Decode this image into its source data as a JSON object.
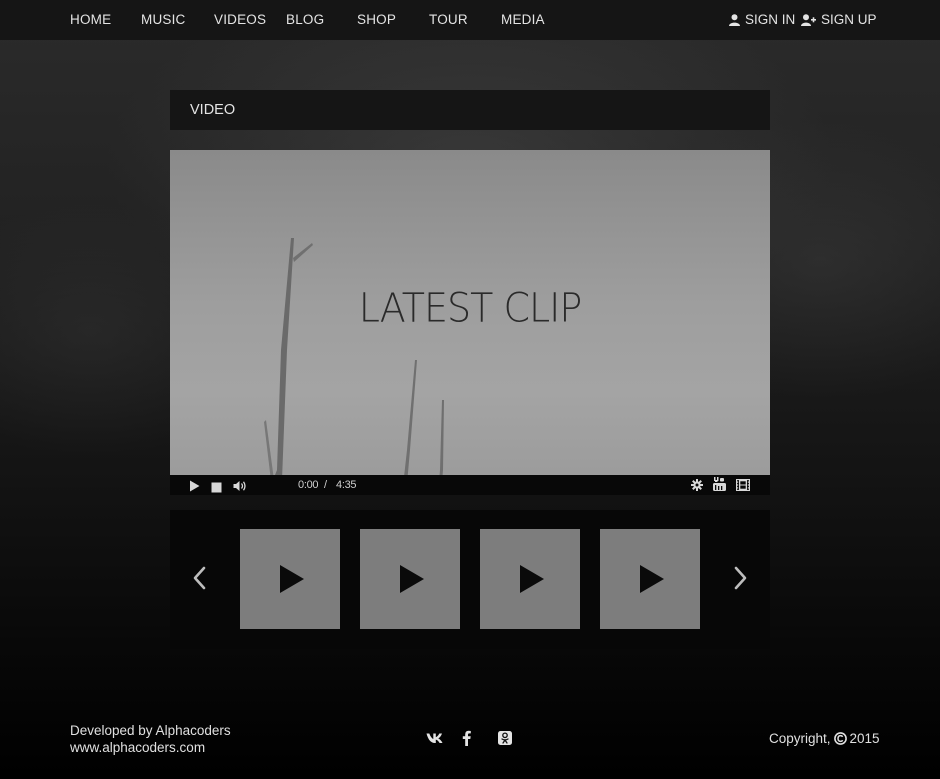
{
  "nav": {
    "items": [
      {
        "label": "HOME"
      },
      {
        "label": "MUSIC"
      },
      {
        "label": "VIDEOS"
      },
      {
        "label": "BLOG"
      },
      {
        "label": "SHOP"
      },
      {
        "label": "TOUR"
      },
      {
        "label": "MEDIA"
      }
    ],
    "sign_in": {
      "label": "SIGN IN",
      "icon": "user-icon"
    },
    "sign_up": {
      "label": "SIGN UP",
      "icon": "user-plus-icon"
    }
  },
  "section": {
    "title": "VIDEO"
  },
  "player": {
    "clip_title": "LATEST CLIP",
    "current_time": "0:00",
    "separator": "/",
    "duration": "4:35",
    "controls": [
      "play-icon",
      "stop-icon",
      "volume-icon",
      "settings-gear-icon",
      "youtube-icon",
      "fullscreen-film-icon"
    ]
  },
  "carousel": {
    "prev_icon": "chevron-left-icon",
    "next_icon": "chevron-right-icon",
    "thumbnail_count": 4
  },
  "footer": {
    "developed_by": "Developed by Alphacoders",
    "website": "www.alphacoders.com",
    "social_icons": [
      "vk-icon",
      "facebook-icon",
      "odnoklassniki-icon"
    ],
    "copyright_label": "Copyright,",
    "copyright_year": "2015"
  },
  "colors": {
    "nav_bg": "#151515",
    "thumb_bg": "#7d7d7d",
    "control_bar_bg": "#080808",
    "text": "#e4e4e4"
  }
}
